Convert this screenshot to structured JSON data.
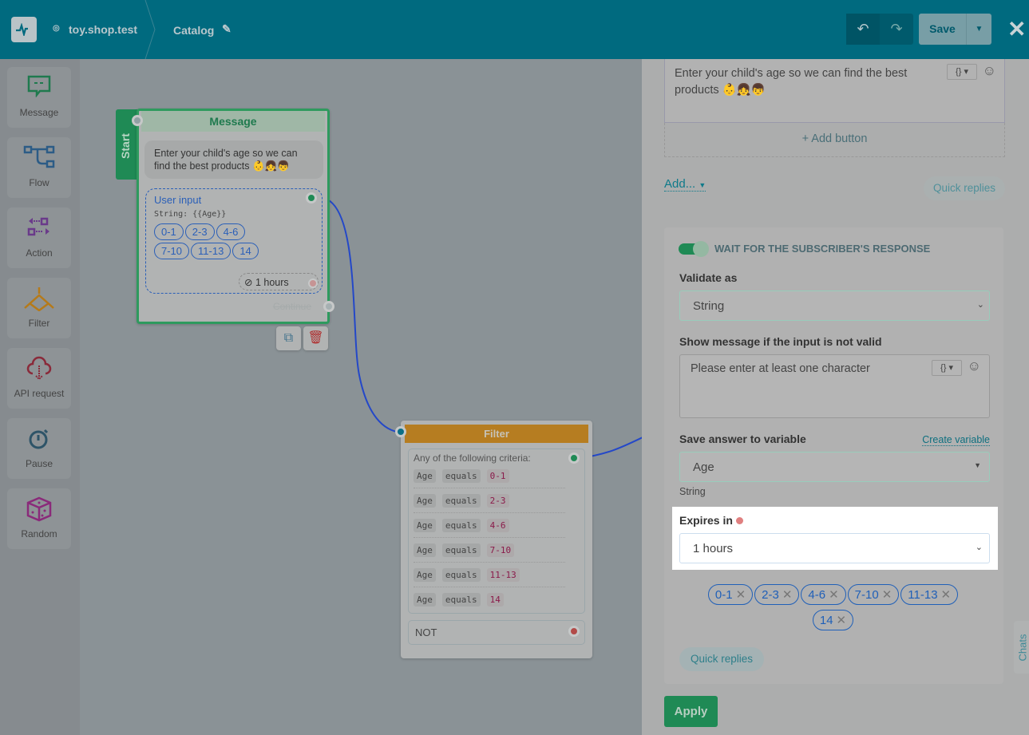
{
  "header": {
    "site": "toy.shop.test",
    "page": "Catalog",
    "save": "Save"
  },
  "sidebar": {
    "items": [
      {
        "label": "Message"
      },
      {
        "label": "Flow"
      },
      {
        "label": "Action"
      },
      {
        "label": "Filter"
      },
      {
        "label": "API request"
      },
      {
        "label": "Pause"
      },
      {
        "label": "Random"
      }
    ]
  },
  "message_node": {
    "start": "Start",
    "title": "Message",
    "text": "Enter your child's age so we can find the best products 👶👧👦",
    "input_title": "User input",
    "input_var": "String: {{Age}}",
    "chips": [
      "0-1",
      "2-3",
      "4-6",
      "7-10",
      "11-13",
      "14"
    ],
    "timeout": "1 hours",
    "continue": "Continue"
  },
  "filter_node": {
    "title": "Filter",
    "criteria_label": "Any of the following criteria:",
    "rows": [
      {
        "var": "Age",
        "op": "equals",
        "value": "0-1"
      },
      {
        "var": "Age",
        "op": "equals",
        "value": "2-3"
      },
      {
        "var": "Age",
        "op": "equals",
        "value": "4-6"
      },
      {
        "var": "Age",
        "op": "equals",
        "value": "7-10"
      },
      {
        "var": "Age",
        "op": "equals",
        "value": "11-13"
      },
      {
        "var": "Age",
        "op": "equals",
        "value": "14"
      }
    ],
    "not_label": "NOT"
  },
  "panel": {
    "message_text": "Enter your child's age so we can find the best products 👶👧👦",
    "add_button": "+ Add button",
    "add_menu": "Add...",
    "quick_replies": "Quick replies",
    "wait_label": "WAIT FOR THE SUBSCRIBER'S RESPONSE",
    "validate_label": "Validate as",
    "validate_value": "String",
    "invalid_label": "Show message if the input is not valid",
    "invalid_text": "Please enter at least one character",
    "save_label": "Save answer to variable",
    "create_variable": "Create variable",
    "variable_value": "Age",
    "variable_type": "String",
    "expires_label": "Expires in",
    "expires_value": "1 hours",
    "chips": [
      "0-1",
      "2-3",
      "4-6",
      "7-10",
      "11-13",
      "14"
    ],
    "quick_replies_btn": "Quick replies",
    "apply": "Apply",
    "chats": "Chats",
    "var_btn": "{}"
  }
}
